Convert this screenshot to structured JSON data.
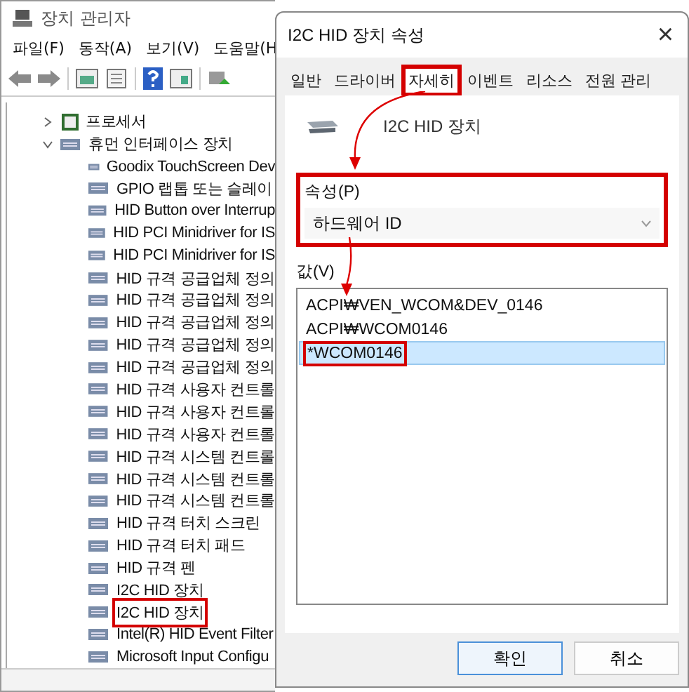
{
  "device_manager": {
    "title": "장치 관리자",
    "menu": [
      "파일(F)",
      "동작(A)",
      "보기(V)",
      "도움말(H"
    ],
    "tree": [
      {
        "label": "프로세서",
        "expanded": false,
        "kind": "processor"
      },
      {
        "label": "휴먼 인터페이스 장치",
        "expanded": true,
        "kind": "hid",
        "children": [
          {
            "label": "Goodix TouchScreen Dev",
            "annotated": false
          },
          {
            "label": "GPIO 랩톱 또는 슬레이",
            "annotated": false
          },
          {
            "label": "HID Button over Interrup",
            "annotated": false
          },
          {
            "label": "HID PCI Minidriver for IS",
            "annotated": false
          },
          {
            "label": "HID PCI Minidriver for IS",
            "annotated": false
          },
          {
            "label": "HID 규격 공급업체 정의",
            "annotated": false
          },
          {
            "label": "HID 규격 공급업체 정의",
            "annotated": false
          },
          {
            "label": "HID 규격 공급업체 정의",
            "annotated": false
          },
          {
            "label": "HID 규격 공급업체 정의",
            "annotated": false
          },
          {
            "label": "HID 규격 공급업체 정의",
            "annotated": false
          },
          {
            "label": "HID 규격 사용자 컨트롤",
            "annotated": false
          },
          {
            "label": "HID 규격 사용자 컨트롤",
            "annotated": false
          },
          {
            "label": "HID 규격 사용자 컨트롤",
            "annotated": false
          },
          {
            "label": "HID 규격 시스템 컨트롤",
            "annotated": false
          },
          {
            "label": "HID 규격 시스템 컨트롤",
            "annotated": false
          },
          {
            "label": "HID 규격 시스템 컨트롤",
            "annotated": false
          },
          {
            "label": "HID 규격 터치 스크린",
            "annotated": false
          },
          {
            "label": "HID 규격 터치 패드",
            "annotated": false
          },
          {
            "label": "HID 규격 펜",
            "annotated": false
          },
          {
            "label": "I2C HID 장치",
            "annotated": false
          },
          {
            "label": "I2C HID 장치",
            "annotated": true
          },
          {
            "label": "Intel(R) HID Event Filter",
            "annotated": false
          },
          {
            "label": "Microsoft Input Configu",
            "annotated": false
          }
        ]
      }
    ]
  },
  "dialog": {
    "title": "I2C HID 장치 속성",
    "close": "×",
    "tabs": [
      {
        "label": "일반",
        "selected": false,
        "annotated": false
      },
      {
        "label": "드라이버",
        "selected": false,
        "annotated": false
      },
      {
        "label": "자세히",
        "selected": true,
        "annotated": true
      },
      {
        "label": "이벤트",
        "selected": false,
        "annotated": false
      },
      {
        "label": "리소스",
        "selected": false,
        "annotated": false
      },
      {
        "label": "전원 관리",
        "selected": false,
        "annotated": false
      }
    ],
    "device_name": "I2C HID 장치",
    "property": {
      "label": "속성(P)",
      "value": "하드웨어 ID",
      "annotated": true
    },
    "values_label": "값(V)",
    "values": [
      {
        "text": "ACPI₩VEN_WCOM&DEV_0146",
        "selected": false
      },
      {
        "text": "ACPI₩WCOM0146",
        "selected": false
      },
      {
        "text": "*WCOM0146",
        "selected": true,
        "annotated": true
      }
    ],
    "buttons": [
      {
        "label": "확인",
        "default": true
      },
      {
        "label": "취소",
        "default": false
      }
    ]
  }
}
